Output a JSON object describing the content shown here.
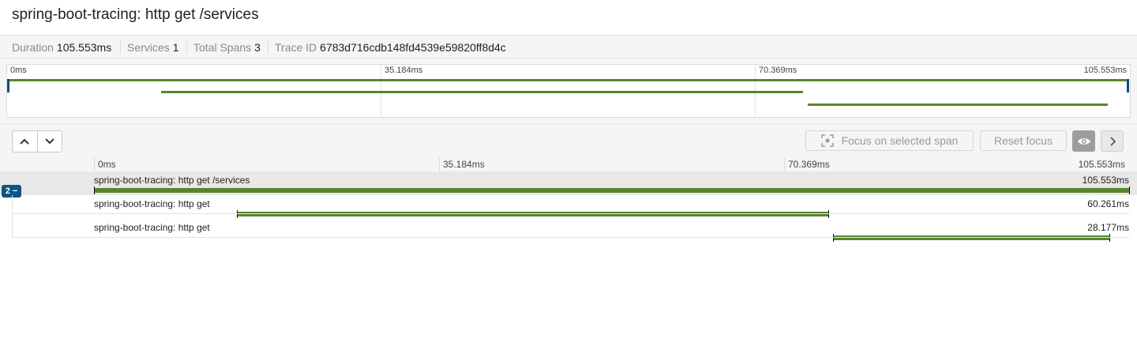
{
  "trace": {
    "title": "spring-boot-tracing: http get /services",
    "summary": {
      "duration_label": "Duration",
      "duration_value": "105.553ms",
      "services_label": "Services",
      "services_value": "1",
      "spans_label": "Total Spans",
      "spans_value": "3",
      "trace_id_label": "Trace ID",
      "trace_id_value": "6783d716cdb148fd4539e59820ff8d4c"
    }
  },
  "minimap": {
    "ticks": [
      "0ms",
      "35.184ms",
      "70.369ms",
      "105.553ms"
    ]
  },
  "toolbar": {
    "up_icon": "chevron-up-icon",
    "down_icon": "chevron-down-icon",
    "focus_label": "Focus on selected span",
    "reset_label": "Reset focus",
    "eye_icon": "eye-icon",
    "expand_icon": "chevron-right-icon"
  },
  "timeline": {
    "ticks": [
      "0ms",
      "35.184ms",
      "70.369ms",
      "105.553ms"
    ]
  },
  "spans": [
    {
      "label": "spring-boot-tracing: http get /services",
      "duration": "105.553ms",
      "children_badge": "2 −"
    },
    {
      "label": "spring-boot-tracing: http get",
      "duration": "60.261ms"
    },
    {
      "label": "spring-boot-tracing: http get",
      "duration": "28.177ms"
    }
  ],
  "colors": {
    "span_bar": "#5a852f",
    "accent": "#0d5585"
  }
}
